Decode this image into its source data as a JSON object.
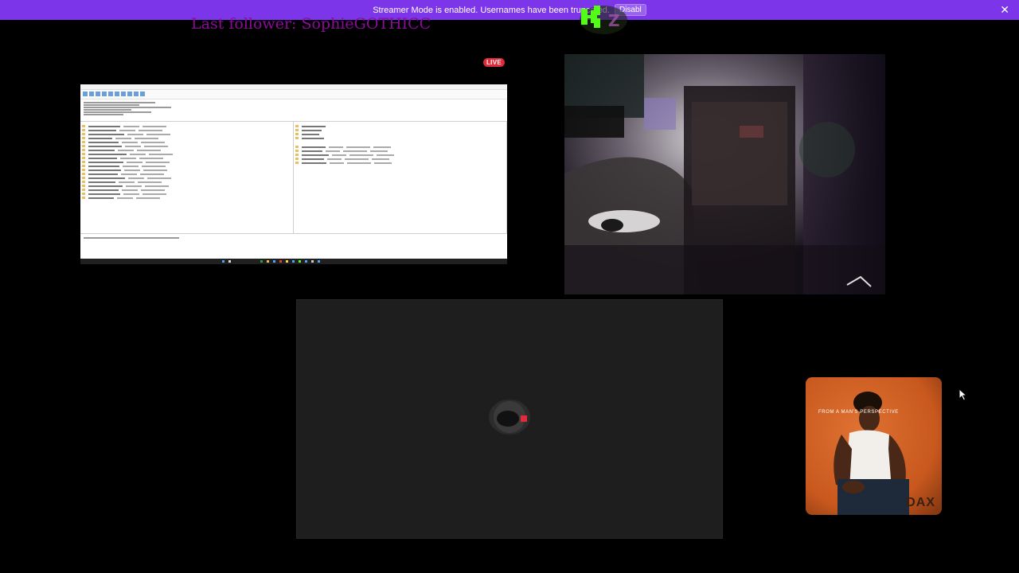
{
  "banner": {
    "text": "Streamer Mode is enabled. Usernames have been truncated.",
    "button_label": "Disabl",
    "close_icon": "close-icon"
  },
  "overlay": {
    "follower_text": "Last follower: SophieGOTHICC",
    "live_label": "LIVE",
    "kick_logo": "K"
  },
  "album": {
    "tagline": "FROM A       MAN'S PERSPECTIVE",
    "artist": "DAX"
  },
  "colors": {
    "banner": "#7c35e8",
    "follower": "#8a0d97",
    "live": "#e22a3a",
    "kick_green": "#53fc18",
    "album_orange": "#c8581e"
  }
}
